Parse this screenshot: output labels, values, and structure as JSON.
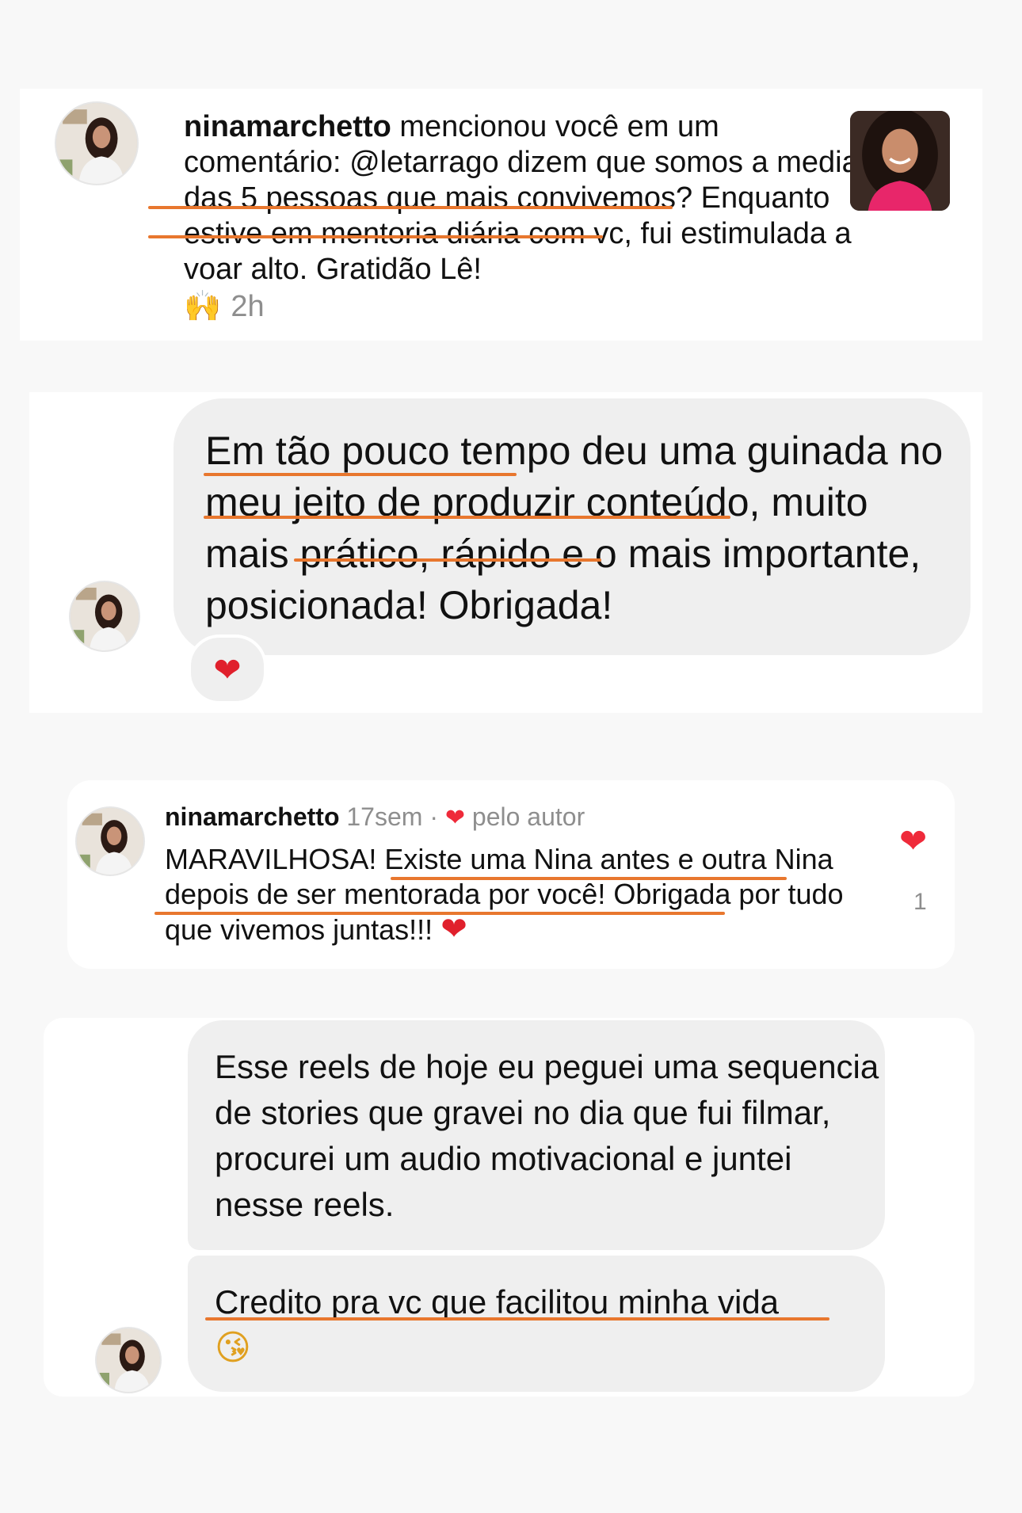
{
  "notification": {
    "username": "ninamarchetto",
    "text": " mencionou você em um comentário: @letarrago dizem que somos a media das 5 pessoas que mais convivemos? Enquanto estive em mentoria diária com vc, fui estimulada a voar alto. Gratidão Lê!",
    "emoji": "🙌",
    "time": "2h"
  },
  "message1": {
    "text": "Em tão pouco tempo deu uma guinada no meu jeito de produzir conteúdo, muito mais prático, rápido e o mais importante, posicionada! Obrigada!",
    "reaction": "❤"
  },
  "comment": {
    "username": "ninamarchetto",
    "time": "17sem",
    "separator": "·",
    "heart": "❤",
    "by_author": "pelo autor",
    "text": "MARAVILHOSA! Existe uma Nina antes e outra Nina depois de ser mentorada por você! Obrigada por tudo que vivemos juntas!!!",
    "emoji": "❤",
    "like_icon": "❤",
    "like_count": "1"
  },
  "message2": {
    "bubble1": "Esse reels de hoje eu peguei uma sequencia de stories que gravei no dia que fui filmar, procurei um audio motivacional e juntei nesse reels.",
    "bubble2": "Credito pra vc que facilitou minha vida",
    "emoji": "😘"
  },
  "colors": {
    "underline": "#e8772e",
    "bubble": "#efefef",
    "heart": "#ef2a3a"
  }
}
